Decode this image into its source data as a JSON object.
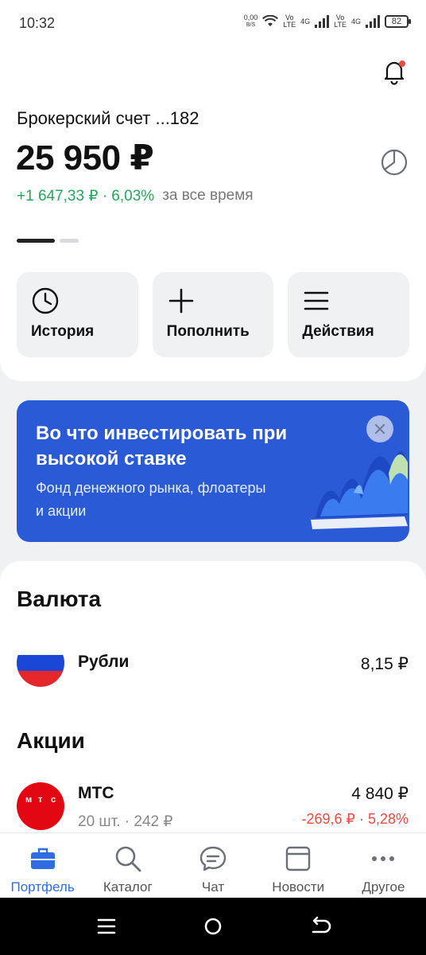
{
  "status_bar": {
    "time": "10:32",
    "net_speed_value": "0,00",
    "net_speed_unit": "B/S",
    "volte_top": "Vo",
    "volte_bottom": "LTE",
    "network_1": "4G",
    "network_2": "4G",
    "battery": "82"
  },
  "header": {
    "notifications_icon": "bell-icon",
    "has_unread": true
  },
  "account": {
    "name": "Брокерский счет ...182",
    "balance": "25 950 ₽",
    "gain": "+1 647,33 ₽ · 6,03%",
    "gain_period": "за все время",
    "gain_color": "#26a55a",
    "allocation_icon": "pie-chart-icon"
  },
  "pager": {
    "pages": 2,
    "active_index": 0
  },
  "actions": [
    {
      "label": "История",
      "icon": "clock-icon"
    },
    {
      "label": "Пополнить",
      "icon": "plus-icon"
    },
    {
      "label": "Действия",
      "icon": "menu-icon"
    }
  ],
  "promo": {
    "title": "Во что инвестировать при высокой ставке",
    "subtitle": "Фонд денежного рынка, флоатеры и акции",
    "background": "#2b5ad6"
  },
  "currency_section": {
    "title": "Валюта",
    "items": [
      {
        "name": "Рубли",
        "value": "8,15 ₽",
        "icon": "russia-flag-icon"
      }
    ]
  },
  "stocks_section": {
    "title": "Акции",
    "items": [
      {
        "name": "МТС",
        "logo_letters": [
          "м",
          "т",
          "с"
        ],
        "quantity": "20 шт. · 242 ₽",
        "value": "4 840 ₽",
        "change": "-269,6 ₽ · 5,28%",
        "change_color": "#f2483f"
      }
    ]
  },
  "tabbar": {
    "active_index": 0,
    "accent": "#2f6de0",
    "tabs": [
      {
        "label": "Портфель",
        "icon": "briefcase-icon"
      },
      {
        "label": "Каталог",
        "icon": "search-icon"
      },
      {
        "label": "Чат",
        "icon": "chat-icon"
      },
      {
        "label": "Новости",
        "icon": "news-icon"
      },
      {
        "label": "Другое",
        "icon": "more-icon"
      }
    ]
  }
}
